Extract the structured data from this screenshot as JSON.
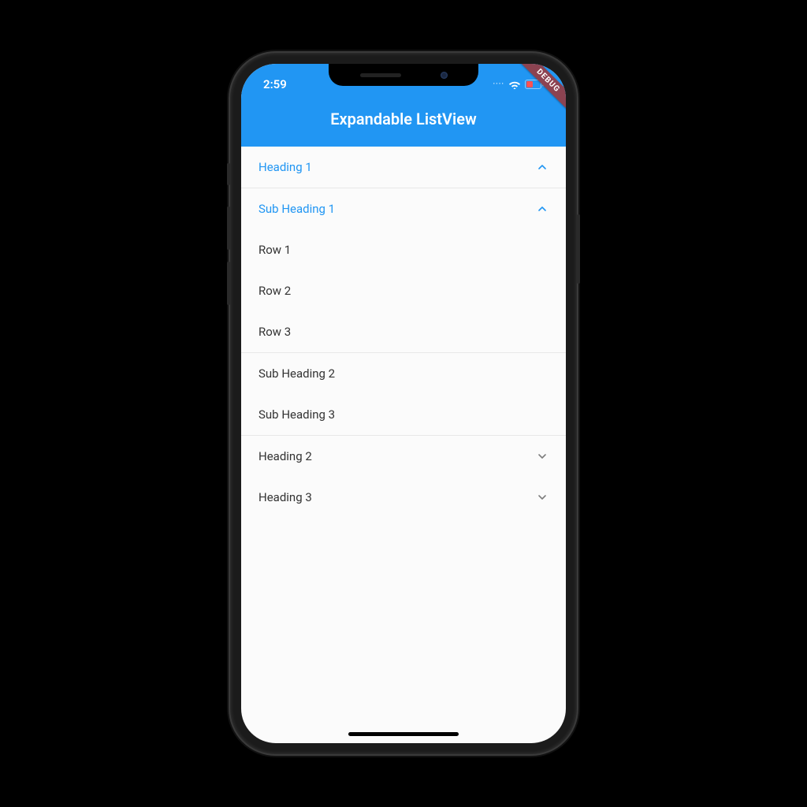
{
  "status": {
    "time": "2:59",
    "signal_dots": "····"
  },
  "debug_label": "DEBUG",
  "app": {
    "title": "Expandable ListView"
  },
  "list": {
    "heading1": {
      "label": "Heading 1",
      "expanded": true
    },
    "sub1": {
      "label": "Sub Heading 1",
      "expanded": true
    },
    "rows": [
      "Row 1",
      "Row 2",
      "Row 3"
    ],
    "sub2": {
      "label": "Sub Heading 2"
    },
    "sub3": {
      "label": "Sub Heading 3"
    },
    "heading2": {
      "label": "Heading 2",
      "expanded": false
    },
    "heading3": {
      "label": "Heading 3",
      "expanded": false
    }
  },
  "colors": {
    "primary": "#2196f3",
    "text": "#333333",
    "divider": "#e8e8e8",
    "debug_banner": "#8c4351"
  }
}
